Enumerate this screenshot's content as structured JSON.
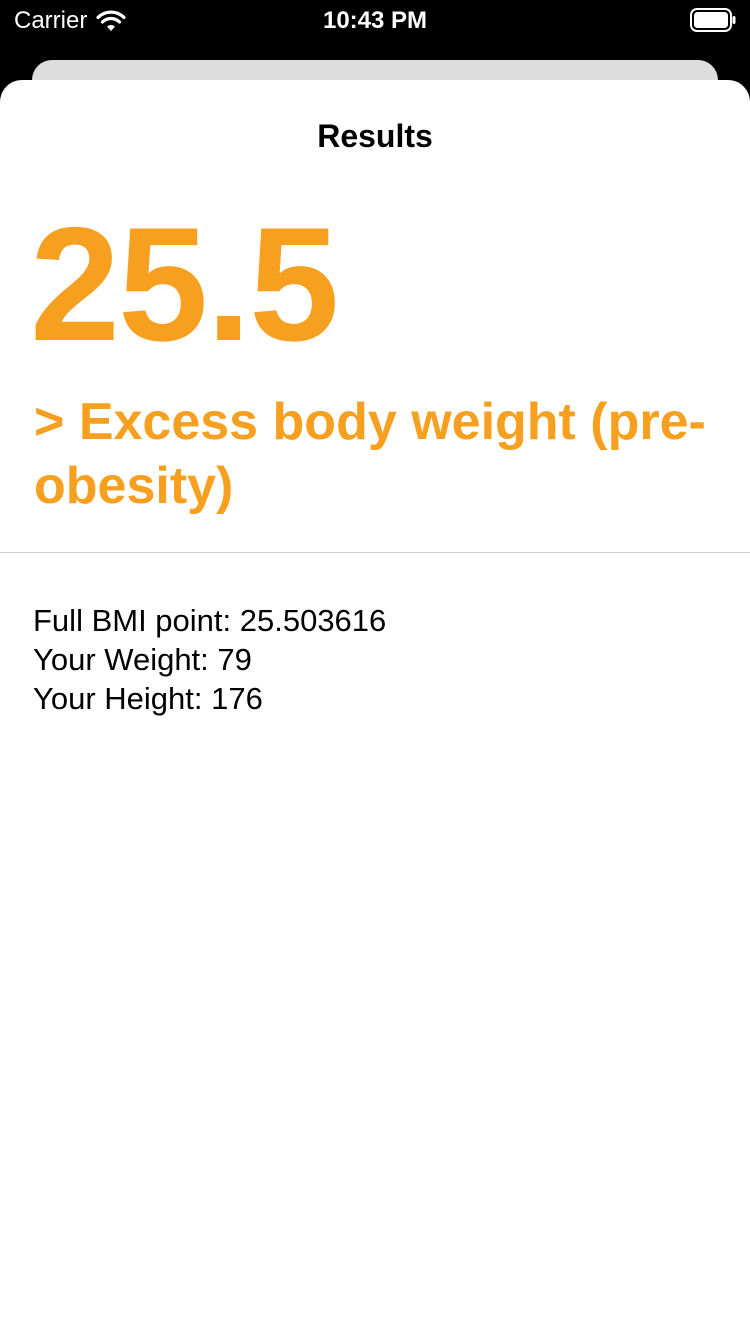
{
  "status_bar": {
    "carrier": "Carrier",
    "time": "10:43 PM"
  },
  "nav": {
    "title": "Results"
  },
  "result": {
    "bmi_value": "25.5",
    "category": "> Excess body weight (pre-obesity)",
    "accent_color": "#f7a020"
  },
  "details": {
    "full_bmi": "Full BMI point: 25.503616",
    "weight": "Your Weight: 79",
    "height": "Your Height: 176"
  },
  "icons": [
    "wifi-icon",
    "battery-icon"
  ]
}
